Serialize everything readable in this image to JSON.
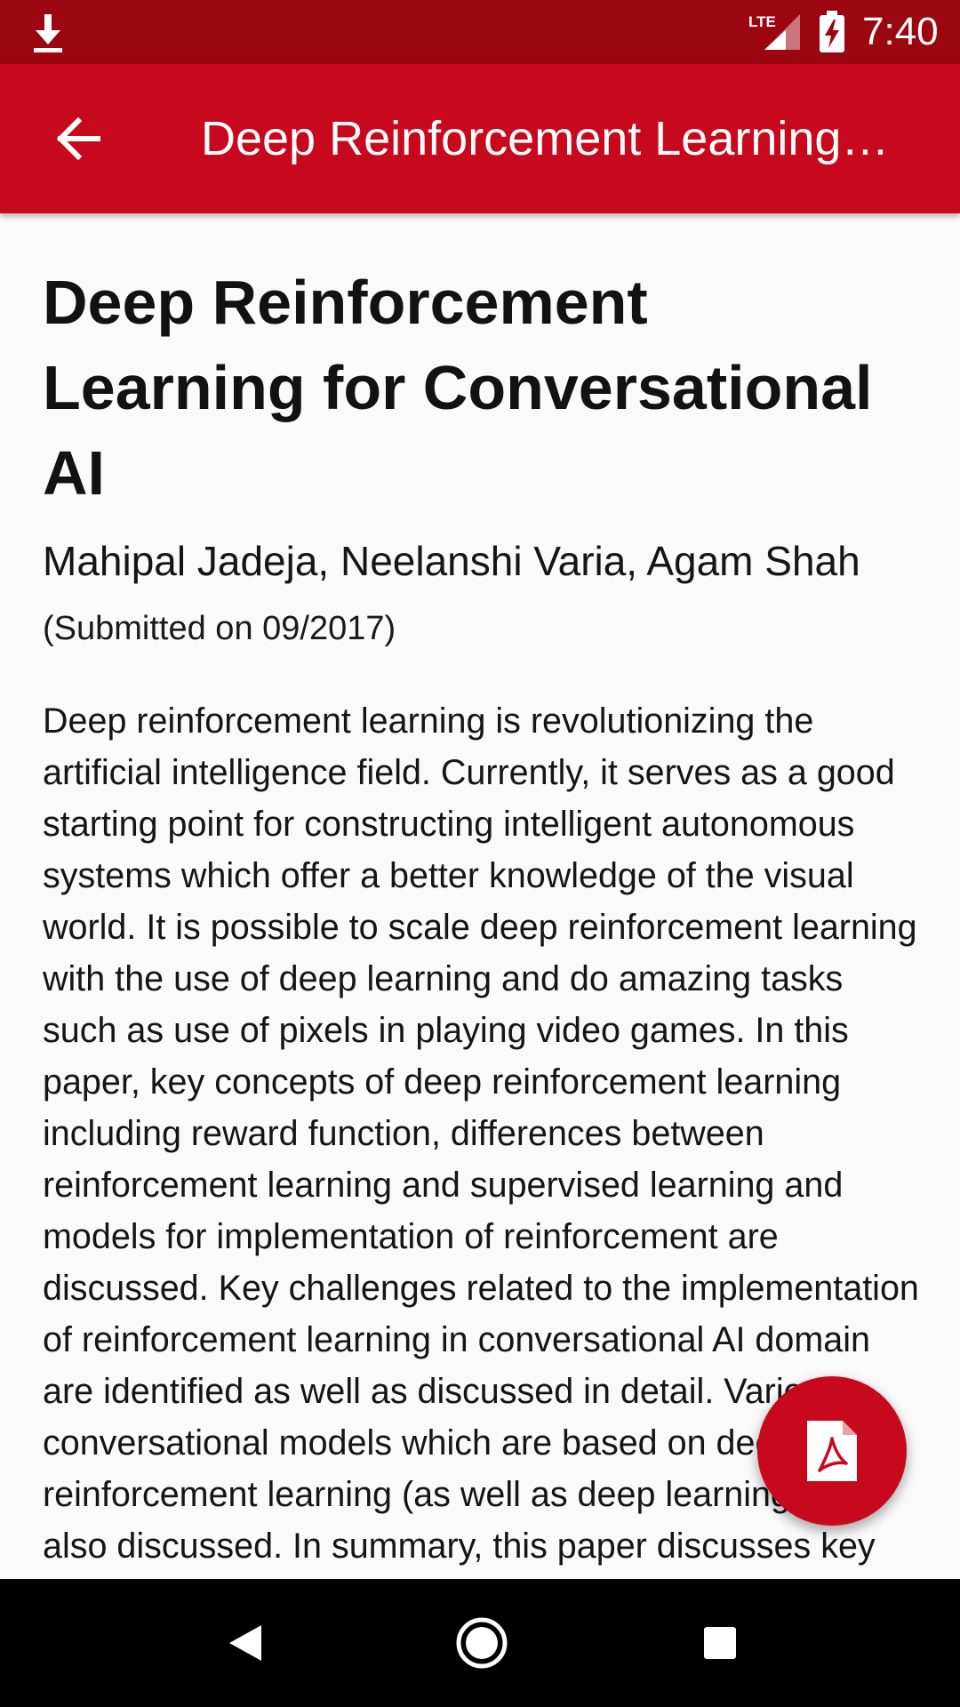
{
  "status_bar": {
    "time": "7:40",
    "network": "LTE",
    "icons": [
      "download-icon",
      "lte-signal-icon",
      "battery-charging-icon"
    ]
  },
  "app_bar": {
    "title": "Deep Reinforcement Learning…",
    "back_icon": "arrow-back-icon"
  },
  "paper": {
    "title": "Deep Reinforcement Learning for Conversational AI",
    "authors": "Mahipal Jadeja, Neelanshi Varia, Agam Shah",
    "submitted": "(Submitted on 09/2017)",
    "abstract": "Deep reinforcement learning is revolutionizing the artificial intelligence field. Currently, it serves as a good starting point for constructing intelligent autonomous systems which offer a better knowledge of the visual world. It is possible to scale deep reinforcement learning with the use of deep learning and do amazing tasks such as use of pixels in playing video games. In this paper, key concepts of deep reinforcement learning including reward function, differences between reinforcement learning and supervised learning and models for implementation of reinforcement are discussed. Key challenges related to the implementation of reinforcement learning in conversational AI domain are identified as well as discussed in detail. Various conversational models which are based on deep reinforcement learning (as well as deep learning) are also discussed. In summary, this paper discusses key aspects of deep reinforcement"
  },
  "fab": {
    "icon": "pdf-icon"
  },
  "nav_bar": {
    "icons": [
      "nav-back-icon",
      "nav-home-icon",
      "nav-recents-icon"
    ]
  },
  "colors": {
    "status_bar": "#9b0610",
    "app_bar": "#c8081d",
    "background": "#fafafa",
    "fab": "#c8081d",
    "nav_bar": "#000000"
  }
}
